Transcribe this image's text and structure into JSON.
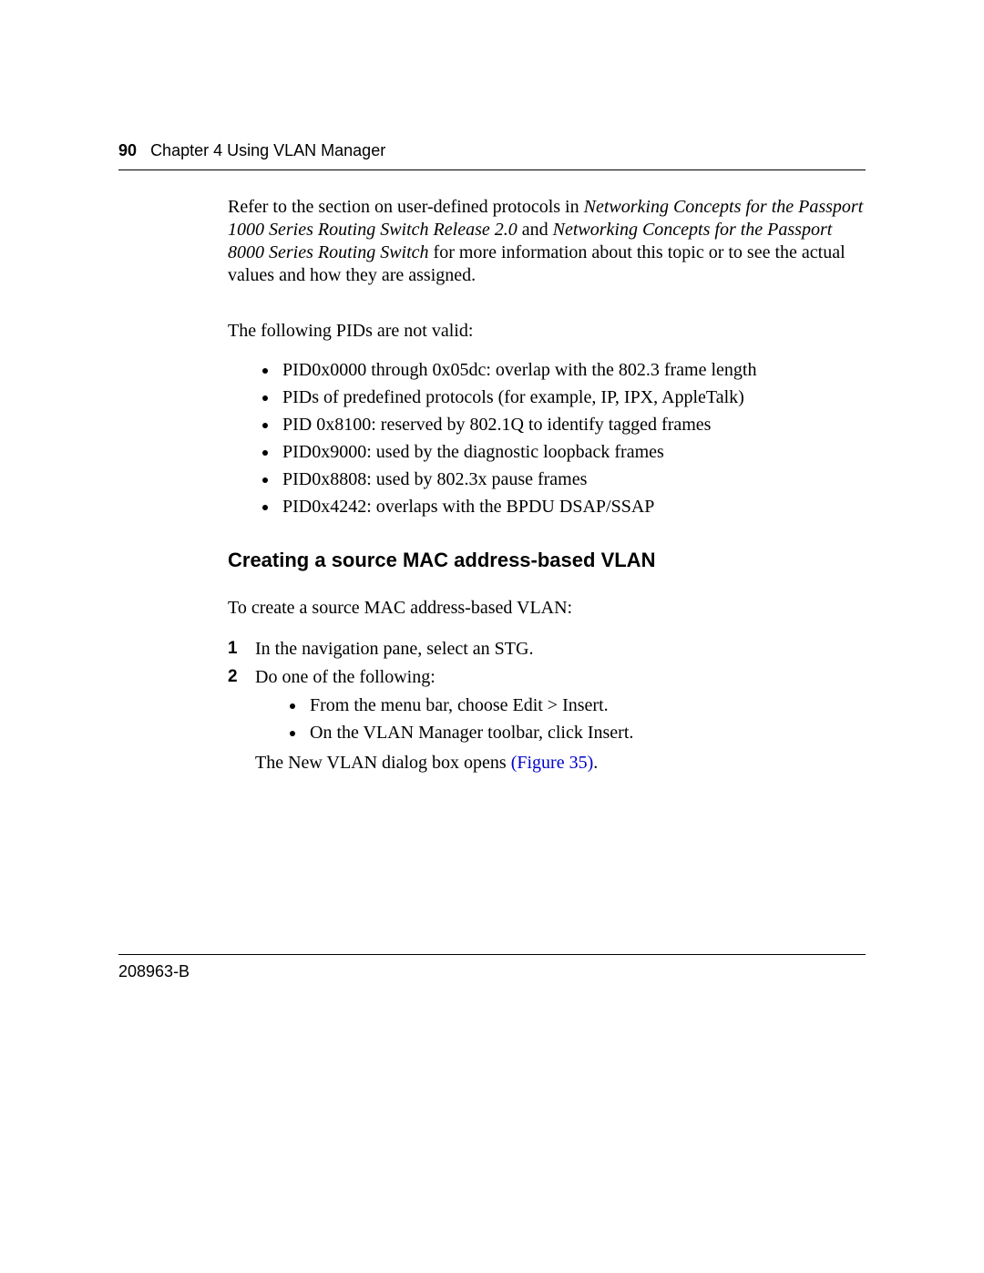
{
  "header": {
    "page_number": "90",
    "chapter_label": "Chapter 4  Using VLAN Manager"
  },
  "body": {
    "intro_para": {
      "pre": "Refer to the section on user-defined protocols in ",
      "em1": "Networking Concepts for the Passport 1000 Series Routing Switch Release 2.0",
      "mid": " and ",
      "em2": "Networking Concepts for the Passport 8000 Series Routing Switch",
      "post": " for more information about this topic or to see the actual values and how they are assigned."
    },
    "pids_intro": "The following PIDs are not valid:",
    "pid_items": [
      "PID0x0000 through 0x05dc: overlap with the 802.3 frame length",
      "PIDs of predefined protocols (for example, IP, IPX, AppleTalk)",
      "PID 0x8100: reserved by 802.1Q to identify tagged frames",
      "PID0x9000: used by the diagnostic loopback frames",
      "PID0x8808: used by 802.3x pause frames",
      "PID0x4242: overlaps with the BPDU DSAP/SSAP"
    ],
    "section_heading": "Creating a source MAC address-based VLAN",
    "proc_intro": "To create a source MAC address-based VLAN:",
    "steps": [
      {
        "num": "1",
        "text": "In the navigation pane, select an STG."
      },
      {
        "num": "2",
        "text": "Do one of the following:"
      }
    ],
    "step2_options": [
      "From the menu bar, choose Edit > Insert.",
      "On the VLAN Manager toolbar, click Insert."
    ],
    "step2_result_pre": "The New VLAN dialog box opens ",
    "step2_result_link": "(Figure 35)",
    "step2_result_post": "."
  },
  "footer": {
    "doc_id": "208963-B"
  }
}
